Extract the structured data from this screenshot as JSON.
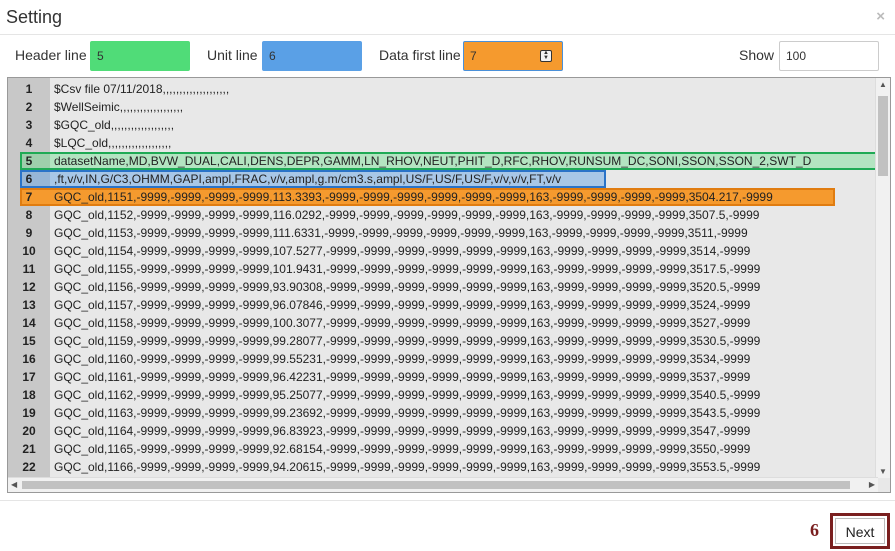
{
  "dialog": {
    "title": "Setting",
    "close": "×"
  },
  "controls": {
    "header_line_label": "Header line",
    "header_line_value": "5",
    "unit_line_label": "Unit line",
    "unit_line_value": "6",
    "data_first_line_label": "Data first line",
    "data_first_line_value": "7",
    "show_label": "Show",
    "show_value": "100"
  },
  "colors": {
    "header": "#50dc78",
    "unit": "#5aa0e6",
    "data_first": "#f59a2e",
    "accent": "#7a1f1f"
  },
  "lines": [
    {
      "n": "1",
      "text": "$Csv file 07/11/2018,,,,,,,,,,,,,,,,,,,,",
      "hl": ""
    },
    {
      "n": "2",
      "text": "$WellSeimic,,,,,,,,,,,,,,,,,,,",
      "hl": ""
    },
    {
      "n": "3",
      "text": "$GQC_old,,,,,,,,,,,,,,,,,,,",
      "hl": ""
    },
    {
      "n": "4",
      "text": "$LQC_old,,,,,,,,,,,,,,,,,,,",
      "hl": ""
    },
    {
      "n": "5",
      "text": "datasetName,MD,BVW_DUAL,CALI,DENS,DEPR,GAMM,LN_RHOV,NEUT,PHIT_D,RFC,RHOV,RUNSUM_DC,SONI,SSON,SSON_2,SWT_D",
      "hl": "green"
    },
    {
      "n": "6",
      "text": ",ft,v/v,IN,G/C3,OHMM,GAPI,ampl,FRAC,v/v,ampl,g.m/cm3.s,ampl,US/F,US/F,US/F,v/v,v/v,FT,v/v",
      "hl": "blue"
    },
    {
      "n": "7",
      "text": "GQC_old,1151,-9999,-9999,-9999,-9999,113.3393,-9999,-9999,-9999,-9999,-9999,-9999,163,-9999,-9999,-9999,-9999,3504.217,-9999",
      "hl": "orange"
    },
    {
      "n": "8",
      "text": "GQC_old,1152,-9999,-9999,-9999,-9999,116.0292,-9999,-9999,-9999,-9999,-9999,-9999,163,-9999,-9999,-9999,-9999,3507.5,-9999",
      "hl": ""
    },
    {
      "n": "9",
      "text": "GQC_old,1153,-9999,-9999,-9999,-9999,111.6331,-9999,-9999,-9999,-9999,-9999,-9999,163,-9999,-9999,-9999,-9999,3511,-9999",
      "hl": ""
    },
    {
      "n": "10",
      "text": "GQC_old,1154,-9999,-9999,-9999,-9999,107.5277,-9999,-9999,-9999,-9999,-9999,-9999,163,-9999,-9999,-9999,-9999,3514,-9999",
      "hl": ""
    },
    {
      "n": "11",
      "text": "GQC_old,1155,-9999,-9999,-9999,-9999,101.9431,-9999,-9999,-9999,-9999,-9999,-9999,163,-9999,-9999,-9999,-9999,3517.5,-9999",
      "hl": ""
    },
    {
      "n": "12",
      "text": "GQC_old,1156,-9999,-9999,-9999,-9999,93.90308,-9999,-9999,-9999,-9999,-9999,-9999,163,-9999,-9999,-9999,-9999,3520.5,-9999",
      "hl": ""
    },
    {
      "n": "13",
      "text": "GQC_old,1157,-9999,-9999,-9999,-9999,96.07846,-9999,-9999,-9999,-9999,-9999,-9999,163,-9999,-9999,-9999,-9999,3524,-9999",
      "hl": ""
    },
    {
      "n": "14",
      "text": "GQC_old,1158,-9999,-9999,-9999,-9999,100.3077,-9999,-9999,-9999,-9999,-9999,-9999,163,-9999,-9999,-9999,-9999,3527,-9999",
      "hl": ""
    },
    {
      "n": "15",
      "text": "GQC_old,1159,-9999,-9999,-9999,-9999,99.28077,-9999,-9999,-9999,-9999,-9999,-9999,163,-9999,-9999,-9999,-9999,3530.5,-9999",
      "hl": ""
    },
    {
      "n": "16",
      "text": "GQC_old,1160,-9999,-9999,-9999,-9999,99.55231,-9999,-9999,-9999,-9999,-9999,-9999,163,-9999,-9999,-9999,-9999,3534,-9999",
      "hl": ""
    },
    {
      "n": "17",
      "text": "GQC_old,1161,-9999,-9999,-9999,-9999,96.42231,-9999,-9999,-9999,-9999,-9999,-9999,163,-9999,-9999,-9999,-9999,3537,-9999",
      "hl": ""
    },
    {
      "n": "18",
      "text": "GQC_old,1162,-9999,-9999,-9999,-9999,95.25077,-9999,-9999,-9999,-9999,-9999,-9999,163,-9999,-9999,-9999,-9999,3540.5,-9999",
      "hl": ""
    },
    {
      "n": "19",
      "text": "GQC_old,1163,-9999,-9999,-9999,-9999,99.23692,-9999,-9999,-9999,-9999,-9999,-9999,163,-9999,-9999,-9999,-9999,3543.5,-9999",
      "hl": ""
    },
    {
      "n": "20",
      "text": "GQC_old,1164,-9999,-9999,-9999,-9999,96.83923,-9999,-9999,-9999,-9999,-9999,-9999,163,-9999,-9999,-9999,-9999,3547,-9999",
      "hl": ""
    },
    {
      "n": "21",
      "text": "GQC_old,1165,-9999,-9999,-9999,-9999,92.68154,-9999,-9999,-9999,-9999,-9999,-9999,163,-9999,-9999,-9999,-9999,3550,-9999",
      "hl": ""
    },
    {
      "n": "22",
      "text": "GQC_old,1166,-9999,-9999,-9999,-9999,94.20615,-9999,-9999,-9999,-9999,-9999,-9999,163,-9999,-9999,-9999,-9999,3553.5,-9999",
      "hl": ""
    }
  ],
  "footer": {
    "step": "6",
    "next_label": "Next"
  }
}
